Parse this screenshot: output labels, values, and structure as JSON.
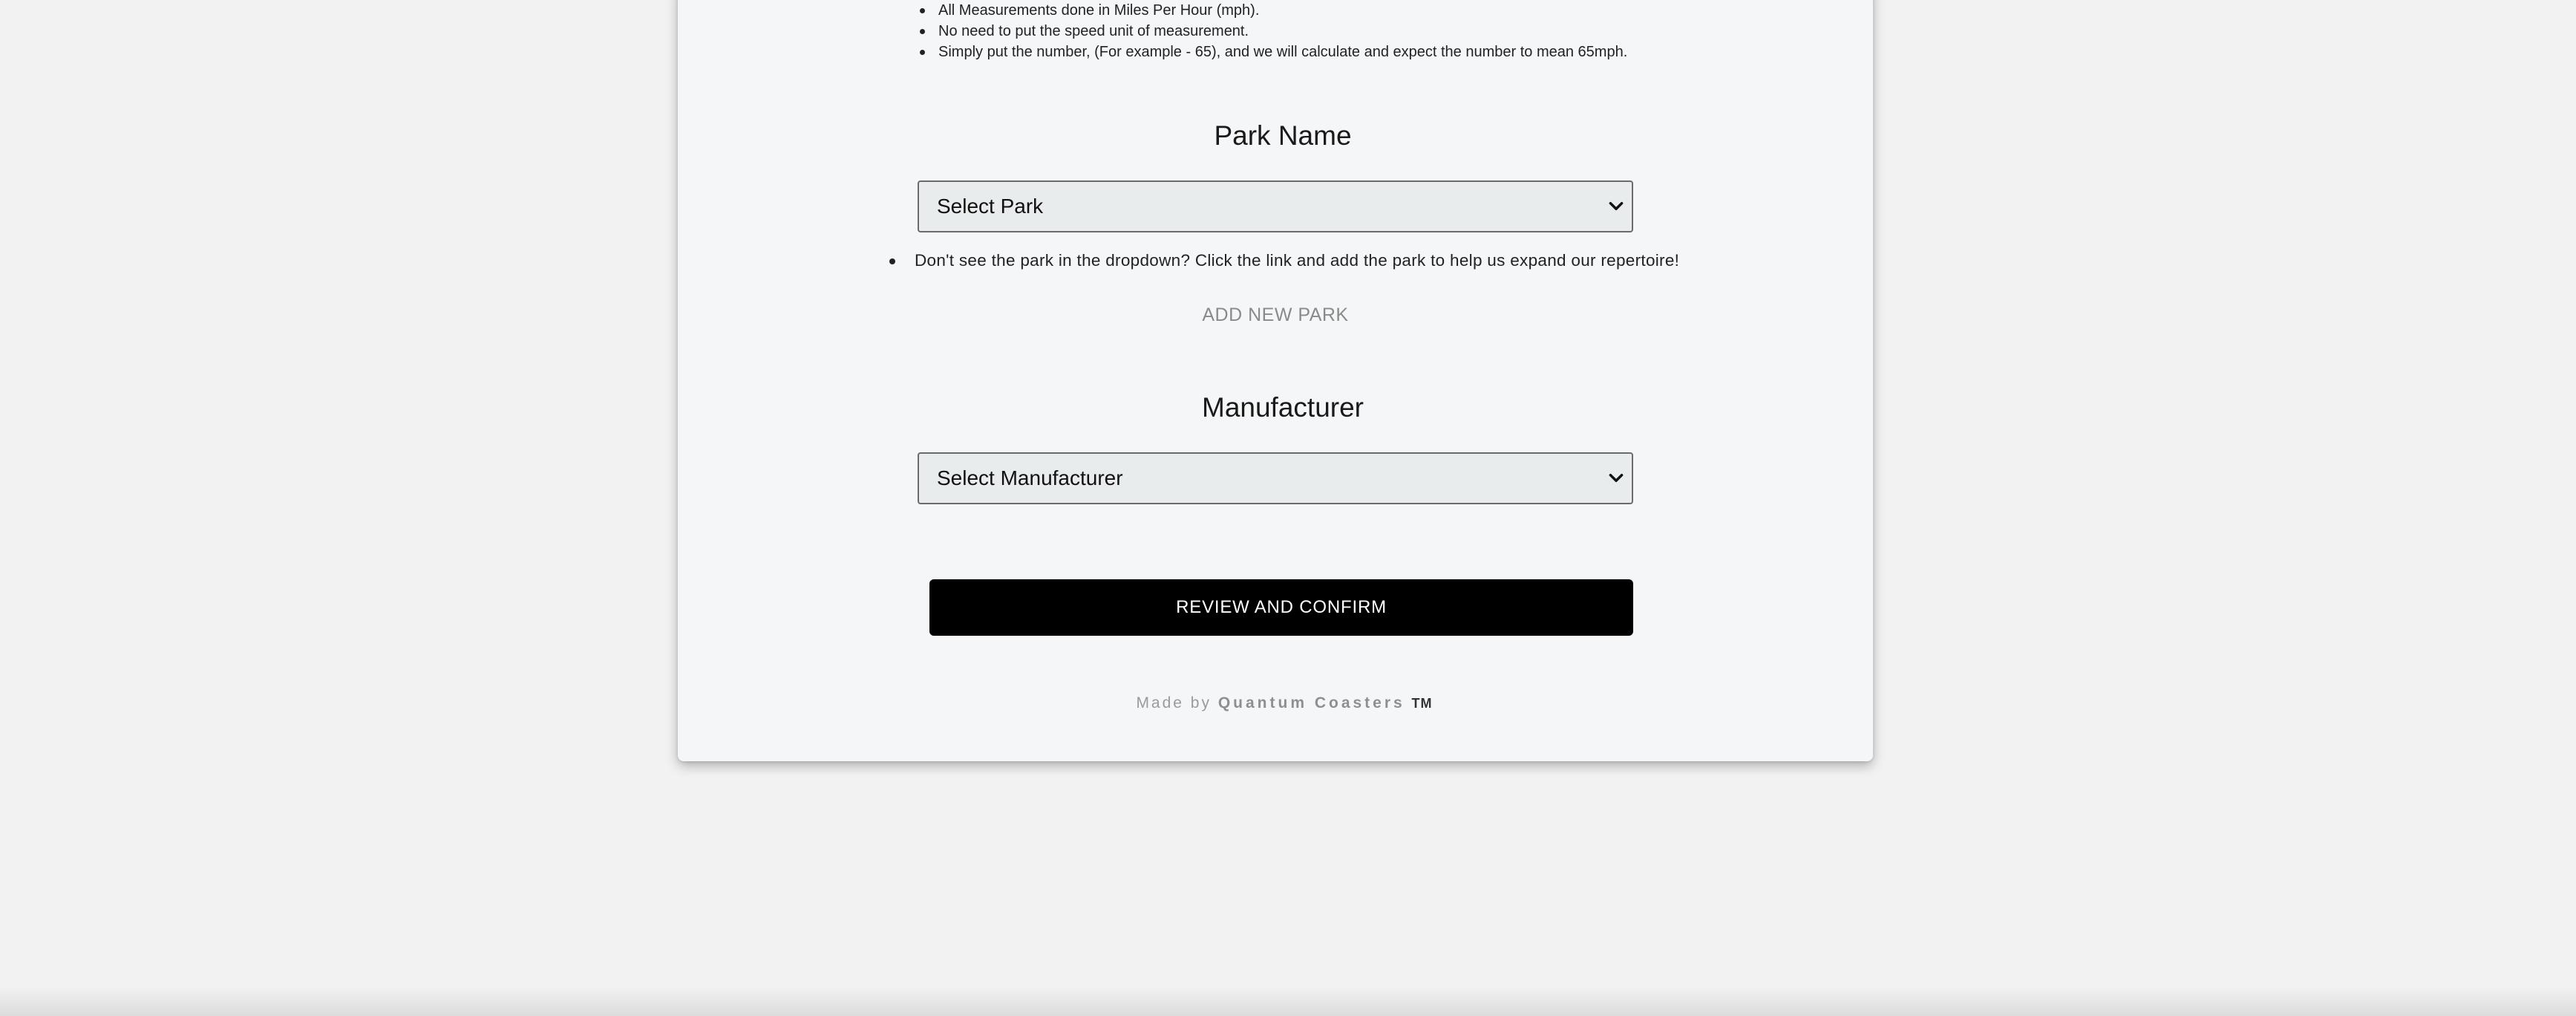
{
  "notes": [
    "All Measurements done in Miles Per Hour (mph).",
    "No need to put the speed unit of measurement.",
    "Simply put the number, (For example - 65), and we will calculate and expect the number to mean 65mph."
  ],
  "park": {
    "title": "Park Name",
    "select_value": "Select Park",
    "hint": "Don't see the park in the dropdown? Click the link and add the park to help us expand our repertoire!",
    "add_link": "ADD NEW PARK"
  },
  "manufacturer": {
    "title": "Manufacturer",
    "select_value": "Select Manufacturer"
  },
  "confirm_label": "REVIEW AND CONFIRM",
  "footer": {
    "prefix": "Made by",
    "brand": "Quantum Coasters",
    "tm": "TM"
  },
  "colors": {
    "page_bg": "#f2f2f2",
    "card_bg": "#f5f6f8",
    "select_bg": "#e8ecec",
    "button_bg": "#000000",
    "button_text": "#ffffff"
  }
}
